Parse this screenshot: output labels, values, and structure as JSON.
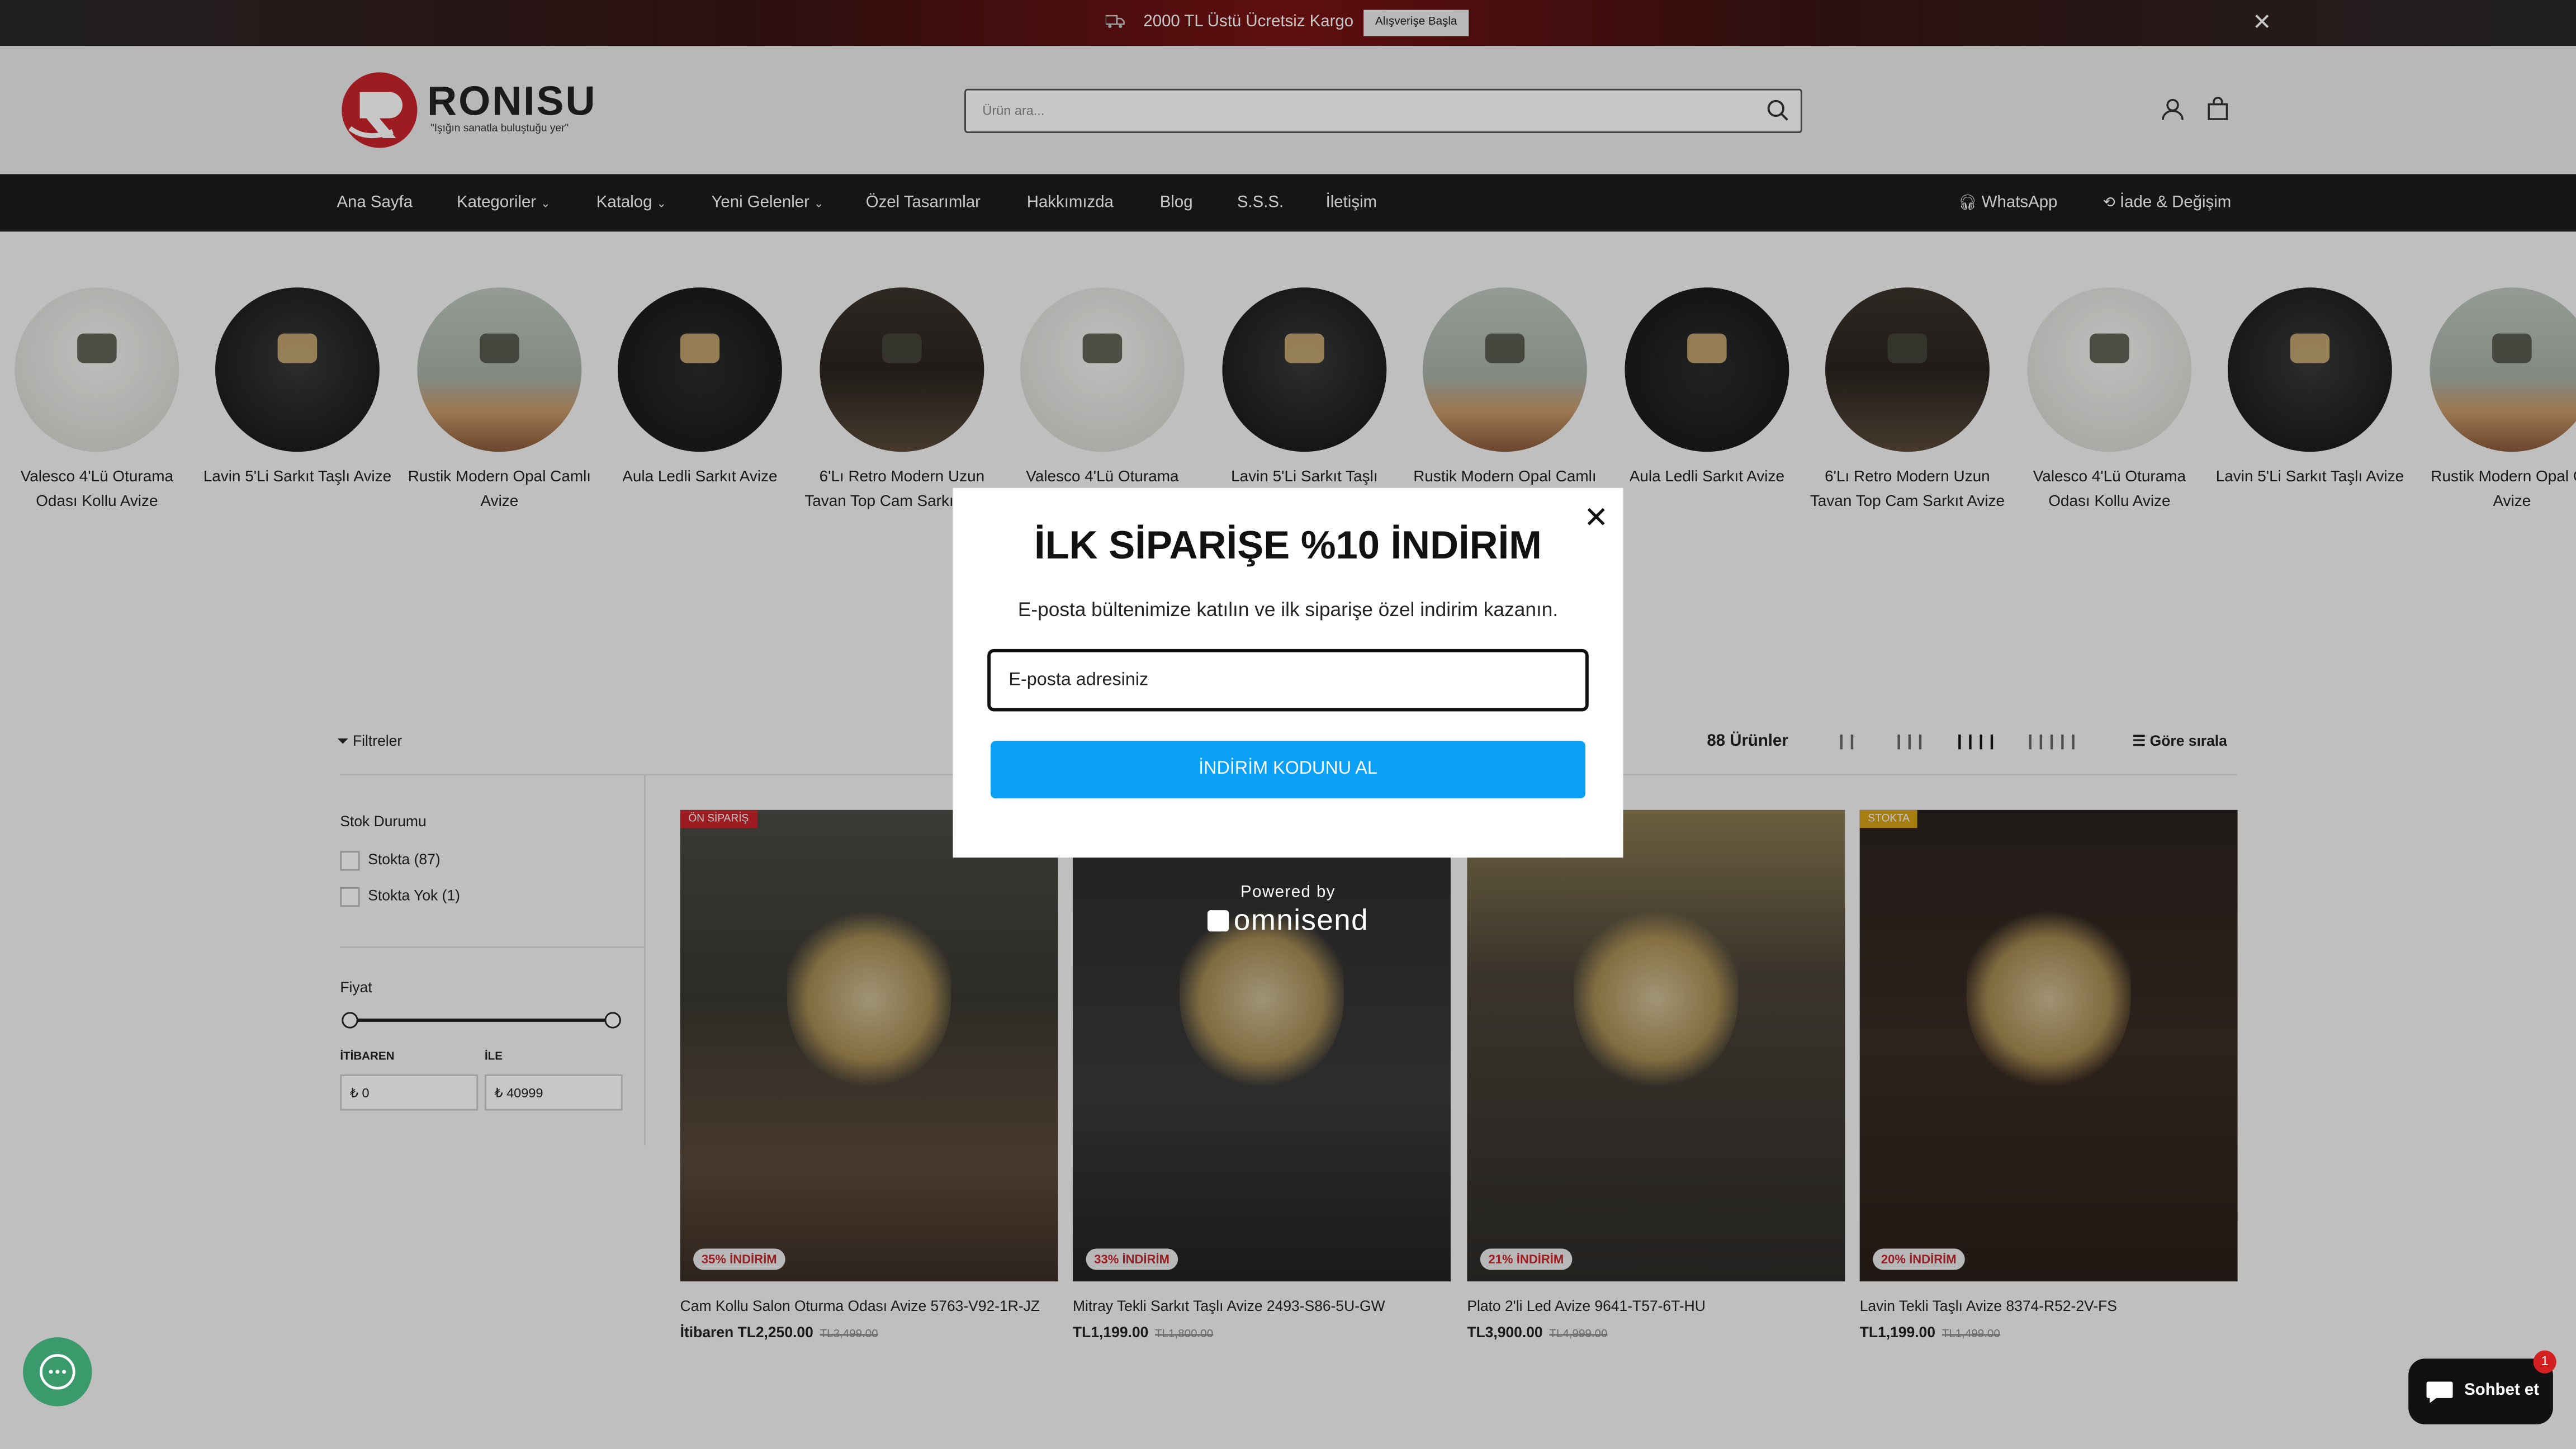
{
  "announcement": {
    "text": "2000 TL Üstü Ücretsiz Kargo",
    "button": "Alışverişe Başla"
  },
  "logo": {
    "brand": "RONISU",
    "tagline": "\"Işığın sanatla buluştuğu yer\""
  },
  "search": {
    "placeholder": "Ürün ara..."
  },
  "nav": {
    "items": [
      "Ana Sayfa",
      "Kategoriler",
      "Katalog",
      "Yeni Gelenler",
      "Özel Tasarımlar",
      "Hakkımızda",
      "Blog",
      "S.S.S.",
      "İletişim"
    ],
    "right": [
      "WhatsApp",
      "İade & Değişim"
    ]
  },
  "stories": [
    "Valesco 4'Lü Oturama Odası Kollu Avize",
    "Lavin 5'Li Sarkıt Taşlı Avize",
    "Rustik Modern Opal Camlı Avize",
    "Aula Ledli Sarkıt Avize",
    "6'Lı Retro Modern Uzun Tavan Top Cam Sarkıt Avize",
    "Valesco 4'Lü Oturama",
    "Lavin 5'Li Sarkıt Taşlı",
    "Rustik Modern Opal Camlı",
    "Aula Ledli Sarkıt Avize",
    "6'Lı Retro Modern Uzun Tavan Top Cam Sarkıt Avize",
    "Valesco 4'Lü Oturama Odası Kollu Avize",
    "Lavin 5'Li Sarkıt Taşlı Avize",
    "Rustik Modern Opal Ca Avize"
  ],
  "toolbar": {
    "filters": "Filtreler",
    "count": "88 Ürünler",
    "sort": "Göre sırala"
  },
  "sidebar": {
    "stock_title": "Stok Durumu",
    "stock_options": [
      "Stokta (87)",
      "Stokta Yok (1)"
    ],
    "price_title": "Fiyat",
    "from_label": "İTİBAREN",
    "to_label": "İLE",
    "from_value": "₺ 0",
    "to_value": "₺ 40999"
  },
  "products": [
    {
      "tag": "ÖN SİPARİŞ",
      "discount": "35% İNDİRİM",
      "title": "Cam Kollu Salon Oturma Odası Avize 5763-V92-1R-JZ",
      "price": "İtibaren TL2,250.00",
      "old": "TL3,499.00"
    },
    {
      "tag": "",
      "discount": "33% İNDİRİM",
      "title": "Mitray Tekli Sarkıt Taşlı Avize 2493-S86-5U-GW",
      "price": "TL1,199.00",
      "old": "TL1,800.00"
    },
    {
      "tag": "",
      "discount": "21% İNDİRİM",
      "title": "Plato 2'li Led Avize 9641-T57-6T-HU",
      "price": "TL3,900.00",
      "old": "TL4,999.00"
    },
    {
      "tag": "STOKTA",
      "discount": "20% İNDİRİM",
      "title": "Lavin Tekli Taşlı Avize 8374-R52-2V-FS",
      "price": "TL1,199.00",
      "old": "TL1,499.00"
    }
  ],
  "popup": {
    "title": "İLK SİPARİŞE %10 İNDİRİM",
    "subtitle": "E-posta bültenimize katılın ve ilk siparişe özel indirim kazanın.",
    "email_placeholder": "E-posta adresiniz",
    "cta": "İNDİRİM KODUNU AL",
    "powered_by": "Powered by",
    "powered_brand": "omnisend"
  },
  "chat": {
    "label": "Sohbet et",
    "badge": "1"
  }
}
